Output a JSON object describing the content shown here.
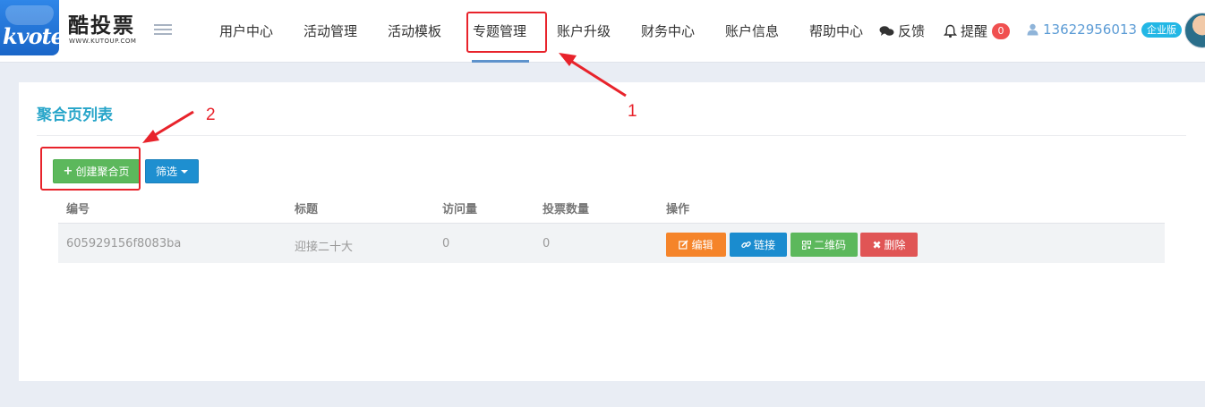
{
  "header": {
    "logo_mark": "kvote",
    "brand_name": "酷投票",
    "brand_url": "WWW.KUTOUP.COM",
    "nav": [
      {
        "label": "用户中心"
      },
      {
        "label": "活动管理"
      },
      {
        "label": "活动模板"
      },
      {
        "label": "专题管理"
      },
      {
        "label": "账户升级"
      },
      {
        "label": "财务中心"
      },
      {
        "label": "账户信息"
      },
      {
        "label": "帮助中心"
      }
    ],
    "feedback_label": "反馈",
    "reminder_label": "提醒",
    "reminder_count": "0",
    "phone": "13622956013",
    "edition_badge": "企业版"
  },
  "panel": {
    "title": "聚合页列表",
    "create_button": "创建聚合页",
    "filter_button": "筛选",
    "columns": [
      "编号",
      "标题",
      "访问量",
      "投票数量",
      "操作"
    ],
    "rows": [
      {
        "id": "605929156f8083ba",
        "title": "迎接二十大",
        "visits": "0",
        "votes": "0"
      }
    ],
    "actions": {
      "edit": "编辑",
      "link": "链接",
      "qrcode": "二维码",
      "delete": "删除"
    }
  },
  "annotations": {
    "step1": "1",
    "step2": "2"
  },
  "colors": {
    "accent": "#27a5c9",
    "annotation": "#e8232b",
    "success": "#5cb85c",
    "primary": "#1a8ccf",
    "warning": "#f5842a",
    "danger": "#e05555"
  }
}
